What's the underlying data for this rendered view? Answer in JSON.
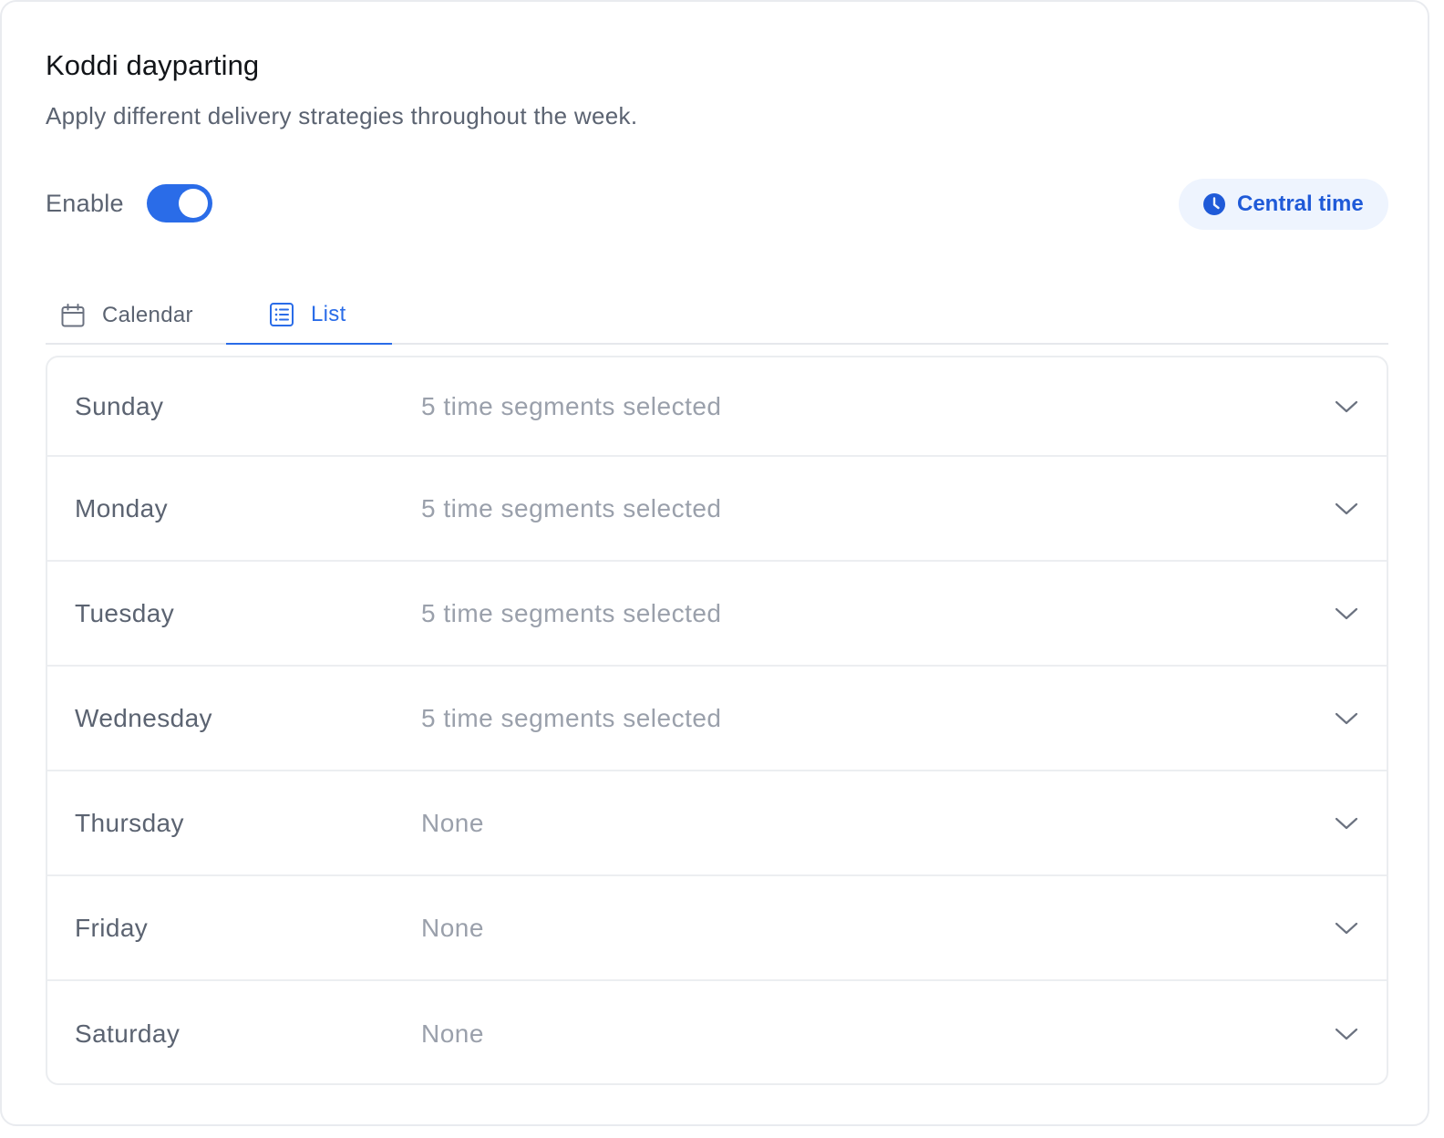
{
  "header": {
    "title": "Koddi dayparting",
    "subtitle": "Apply different delivery strategies throughout the week."
  },
  "enable": {
    "label": "Enable",
    "on": true
  },
  "timezone": {
    "label": "Central time",
    "icon": "clock-icon"
  },
  "tabs": [
    {
      "label": "Calendar",
      "icon": "calendar-icon",
      "active": false
    },
    {
      "label": "List",
      "icon": "list-icon",
      "active": true
    }
  ],
  "days": [
    {
      "name": "Sunday",
      "value": "5 time segments selected"
    },
    {
      "name": "Monday",
      "value": "5 time segments selected"
    },
    {
      "name": "Tuesday",
      "value": "5 time segments selected"
    },
    {
      "name": "Wednesday",
      "value": "5 time segments selected"
    },
    {
      "name": "Thursday",
      "value": "None"
    },
    {
      "name": "Friday",
      "value": "None"
    },
    {
      "name": "Saturday",
      "value": "None"
    }
  ],
  "colors": {
    "accent": "#2a6ce8",
    "pill_background": "#eef4fe",
    "pill_text": "#1f5ad8"
  }
}
